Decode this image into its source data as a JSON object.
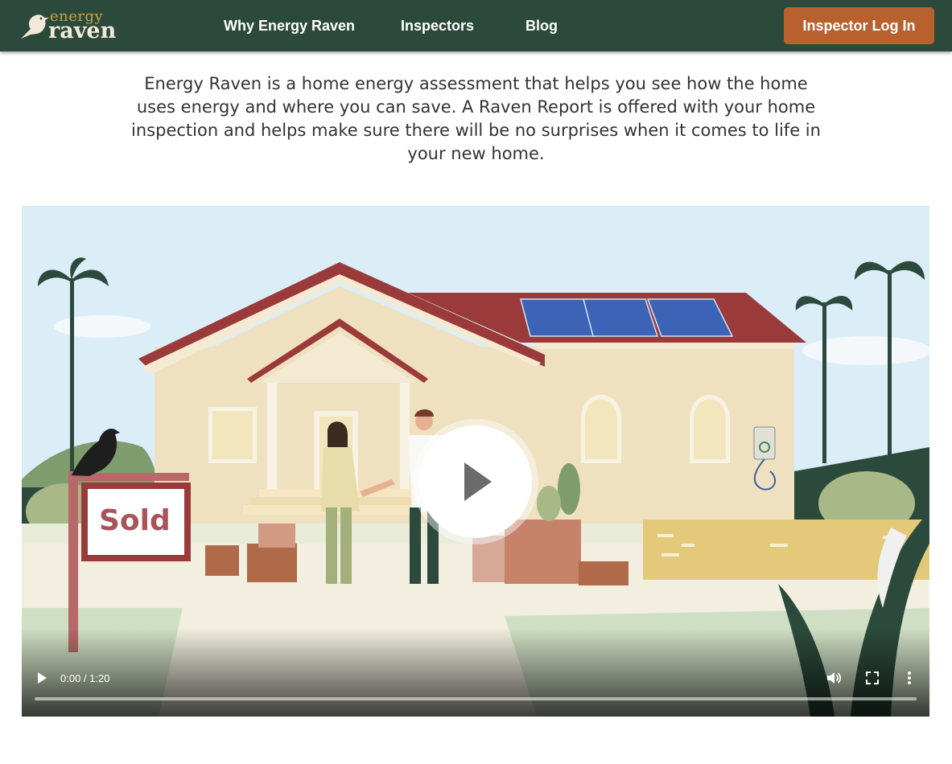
{
  "brand": {
    "logo_top": "energy",
    "logo_bottom": "raven"
  },
  "nav": {
    "items": [
      {
        "label": "Why Energy Raven"
      },
      {
        "label": "Inspectors"
      },
      {
        "label": "Blog"
      }
    ],
    "login_label": "Inspector Log In"
  },
  "intro": {
    "text": "Energy Raven is a home energy assessment that helps you see how the home uses energy and where you can save. A Raven Report is offered with your home inspection and helps make sure there will be no surprises when it comes to life in your new home."
  },
  "video": {
    "sign_text": "Sold",
    "time_display": "0:00 / 1:20",
    "progress": 0,
    "icons": {
      "play": "play-icon",
      "big_play": "play-circle-icon",
      "volume": "volume-icon",
      "fullscreen": "fullscreen-icon",
      "more": "more-vertical-icon"
    }
  },
  "colors": {
    "header_bg": "#2c4a3c",
    "login_bg": "#b8612e",
    "logo_gold": "#c9a24b",
    "logo_cream": "#f2ead8"
  }
}
